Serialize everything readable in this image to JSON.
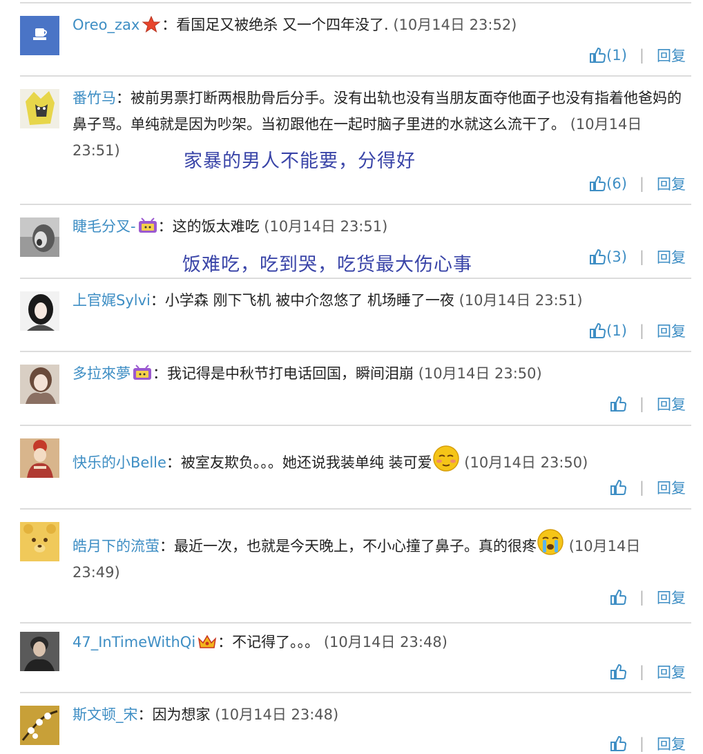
{
  "colors": {
    "link": "#3e8ec4",
    "annotation": "#3a45a8",
    "divider": "#dcdcdc"
  },
  "comments": [
    {
      "username": "Oreo_zax",
      "badge": "star-icon",
      "text": "看国足又被绝杀 又一个四年没了.",
      "timestamp": "(10月14日 23:52)",
      "likes": "(1)",
      "reply": "回复",
      "avatar": "teacup-avatar"
    },
    {
      "username": "番竹马",
      "text": "被前男票打断两根肋骨后分手。没有出轨也没有当朋友面夺他面子也没有指着他爸妈的鼻子骂。单纯就是因为吵架。当初跟他在一起时脑子里进的水就这么流干了。",
      "timestamp": "(10月14日 23:51)",
      "annotation": "家暴的男人不能要，分得好",
      "likes": "(6)",
      "reply": "回复",
      "avatar": "anime-avatar"
    },
    {
      "username": "睫毛分叉-",
      "badge": "tv-icon",
      "text": "这的饭太难吃",
      "timestamp": "(10月14日 23:51)",
      "annotation": "饭难吃，吃到哭，吃货最大伤心事",
      "likes": "(3)",
      "reply": "回复",
      "avatar": "face-avatar"
    },
    {
      "username": "上官娓Sylvi",
      "text": "小学森 刚下飞机 被中介忽悠了 机场睡了一夜",
      "timestamp": "(10月14日 23:51)",
      "likes": "(1)",
      "reply": "回复",
      "avatar": "girl-avatar"
    },
    {
      "username": "多拉來夢",
      "badge": "tv-icon",
      "text": "我记得是中秋节打电话回国，瞬间泪崩",
      "timestamp": "(10月14日 23:50)",
      "likes": "",
      "reply": "回复",
      "avatar": "scarf-avatar"
    },
    {
      "username": "快乐的小Belle",
      "text": "被室友欺负。。。她还说我装单纯 装可爱",
      "emoji": "smug-face-icon",
      "timestamp": "(10月14日 23:50)",
      "likes": "",
      "reply": "回复",
      "avatar": "doll-avatar"
    },
    {
      "username": "皓月下的流萤",
      "text": "最近一次，也就是今天晚上，不小心撞了鼻子。真的很疼",
      "emoji": "crying-face-icon",
      "timestamp": "(10月14日 23:49)",
      "likes": "",
      "reply": "回复",
      "avatar": "bear-avatar"
    },
    {
      "username": "47_InTimeWithQi",
      "badge": "crown-icon",
      "text": "不记得了。。。",
      "timestamp": "(10月14日 23:48)",
      "likes": "",
      "reply": "回复",
      "avatar": "man-avatar"
    },
    {
      "username": "斯文顿_宋",
      "text": "因为想家",
      "timestamp": "(10月14日 23:48)",
      "likes": "",
      "reply": "回复",
      "avatar": "blossom-avatar"
    }
  ]
}
